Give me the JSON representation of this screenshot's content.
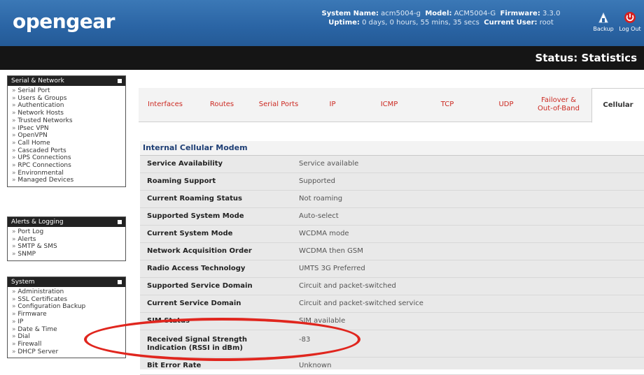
{
  "header": {
    "logo": "opengear",
    "system_name_label": "System Name:",
    "system_name": "acm5004-g",
    "model_label": "Model:",
    "model": "ACM5004-G",
    "firmware_label": "Firmware:",
    "firmware": "3.3.0",
    "uptime_label": "Uptime:",
    "uptime": "0 days, 0 hours, 55 mins, 35 secs",
    "current_user_label": "Current User:",
    "current_user": "root",
    "backup_label": "Backup",
    "logout_label": "Log Out"
  },
  "page_title": "Status: Statistics",
  "sidebar": {
    "serial_network": {
      "title": "Serial & Network",
      "items": [
        "Serial Port",
        "Users & Groups",
        "Authentication",
        "Network Hosts",
        "Trusted Networks",
        "IPsec VPN",
        "OpenVPN",
        "Call Home",
        "Cascaded Ports",
        "UPS Connections",
        "RPC Connections",
        "Environmental",
        "Managed Devices"
      ]
    },
    "alerts_logging": {
      "title": "Alerts & Logging",
      "items": [
        "Port Log",
        "Alerts",
        "SMTP & SMS",
        "SNMP"
      ]
    },
    "system": {
      "title": "System",
      "items": [
        "Administration",
        "SSL Certificates",
        "Configuration Backup",
        "Firmware",
        "IP",
        "Date & Time",
        "Dial",
        "Firewall",
        "DHCP Server"
      ]
    }
  },
  "tabs": [
    "Interfaces",
    "Routes",
    "Serial Ports",
    "IP",
    "ICMP",
    "TCP",
    "UDP",
    "Failover & Out-of-Band",
    "Cellular"
  ],
  "active_tab": "Cellular",
  "table": {
    "heading": "Internal Cellular Modem",
    "rows": [
      {
        "label": "Service Availability",
        "value": "Service available"
      },
      {
        "label": "Roaming Support",
        "value": "Supported"
      },
      {
        "label": "Current Roaming Status",
        "value": "Not roaming"
      },
      {
        "label": "Supported System Mode",
        "value": "Auto-select"
      },
      {
        "label": "Current System Mode",
        "value": "WCDMA mode"
      },
      {
        "label": "Network Acquisition Order",
        "value": "WCDMA then GSM"
      },
      {
        "label": "Radio Access Technology",
        "value": "UMTS 3G Preferred"
      },
      {
        "label": "Supported Service Domain",
        "value": "Circuit and packet-switched"
      },
      {
        "label": "Current Service Domain",
        "value": "Circuit and packet-switched service"
      },
      {
        "label": "SIM Status",
        "value": "SIM available"
      },
      {
        "label": "Received Signal Strength Indication (RSSI in dBm)",
        "value": "-83"
      },
      {
        "label": "Bit Error Rate",
        "value": "Unknown"
      }
    ]
  },
  "colors": {
    "header_blue": "#2a64a4",
    "title_bar": "#151515",
    "tab_link": "#cc2a22",
    "heading_blue": "#1f3f75",
    "highlight_oval": "#e0261e"
  }
}
